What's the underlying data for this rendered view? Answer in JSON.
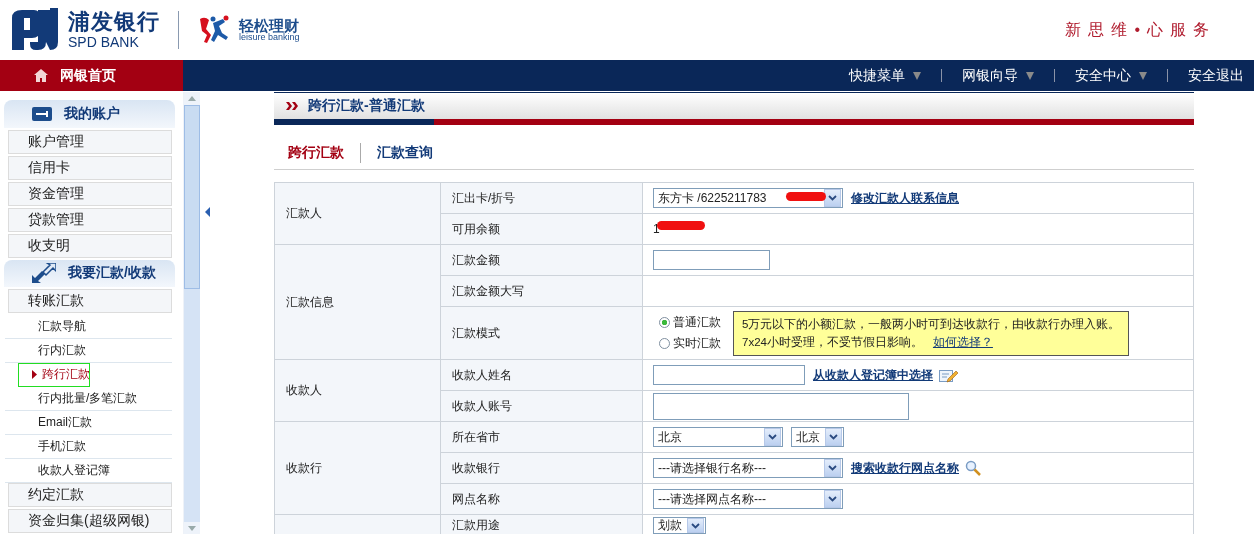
{
  "header": {
    "bank_name": "浦发银行",
    "bank_name_en": "SPD BANK",
    "brand": "轻松理财",
    "brand_en": "leisure banking",
    "slogan": "新思维•心服务"
  },
  "nav": {
    "home": "网银首页",
    "items": [
      {
        "label": "快捷菜单",
        "has_menu": true
      },
      {
        "label": "网银向导",
        "has_menu": true
      },
      {
        "label": "安全中心",
        "has_menu": true
      },
      {
        "label": "安全退出",
        "has_menu": false
      }
    ]
  },
  "sidebar": {
    "sections": [
      {
        "title": "我的账户",
        "items": [
          {
            "label": "账户管理",
            "kind": "main",
            "selected": false
          },
          {
            "label": "信用卡",
            "kind": "main",
            "selected": false
          },
          {
            "label": "资金管理",
            "kind": "main",
            "selected": false
          },
          {
            "label": "贷款管理",
            "kind": "main",
            "selected": false
          },
          {
            "label": "收支明",
            "kind": "main",
            "selected": false
          }
        ]
      },
      {
        "title": "我要汇款/收款",
        "items": [
          {
            "label": "转账汇款",
            "kind": "main",
            "selected": false
          },
          {
            "label": "汇款导航",
            "kind": "sub",
            "selected": false
          },
          {
            "label": "行内汇款",
            "kind": "sub",
            "selected": false
          },
          {
            "label": "跨行汇款",
            "kind": "sub",
            "selected": true
          },
          {
            "label": "行内批量/多笔汇款",
            "kind": "sub",
            "selected": false
          },
          {
            "label": "Email汇款",
            "kind": "sub",
            "selected": false
          },
          {
            "label": "手机汇款",
            "kind": "sub",
            "selected": false
          },
          {
            "label": "收款人登记簿",
            "kind": "sub",
            "selected": false
          },
          {
            "label": "约定汇款",
            "kind": "main",
            "selected": false
          },
          {
            "label": "资金归集(超级网银)",
            "kind": "main",
            "selected": false
          }
        ]
      }
    ]
  },
  "page_title": "跨行汇款-普通汇款",
  "tabs": [
    {
      "label": "跨行汇款",
      "selected": true
    },
    {
      "label": "汇款查询",
      "selected": false
    }
  ],
  "form": {
    "groups": [
      {
        "label": "汇款人",
        "rows": [
          {
            "label": "汇出卡/折号",
            "controls": [
              {
                "kind": "select",
                "value": "东方卡 /6225211783",
                "redacted": true
              },
              {
                "kind": "link",
                "text": "修改汇款人联系信息"
              }
            ]
          },
          {
            "label": "可用余额",
            "controls": [
              {
                "kind": "text",
                "value": "1",
                "redacted": true
              }
            ]
          }
        ]
      },
      {
        "label": "汇款信息",
        "rows": [
          {
            "label": "汇款金额",
            "controls": [
              {
                "kind": "input"
              }
            ]
          },
          {
            "label": "汇款金额大写",
            "controls": []
          },
          {
            "label": "汇款模式",
            "controls": [
              {
                "kind": "radio",
                "options": [
                  {
                    "label": "普通汇款",
                    "selected": true
                  },
                  {
                    "label": "实时汇款",
                    "selected": false
                  }
                ]
              },
              {
                "kind": "tip",
                "text": "5万元以下的小额汇款，一般两小时可到达收款行，由收款行办理入账。",
                "text2": "7x24小时受理，不受节假日影响。",
                "link": "如何选择？"
              }
            ]
          }
        ]
      },
      {
        "label": "收款人",
        "rows": [
          {
            "label": "收款人姓名",
            "controls": [
              {
                "kind": "input"
              },
              {
                "kind": "link",
                "text": "从收款人登记簿中选择"
              }
            ]
          },
          {
            "label": "收款人账号",
            "controls": [
              {
                "kind": "input"
              }
            ]
          }
        ]
      },
      {
        "label": "收款行",
        "rows": [
          {
            "label": "所在省市",
            "controls": [
              {
                "kind": "select",
                "value": "北京"
              },
              {
                "kind": "select",
                "value": "北京"
              }
            ]
          },
          {
            "label": "收款银行",
            "controls": [
              {
                "kind": "select",
                "value": "---请选择银行名称---"
              },
              {
                "kind": "link",
                "text": "搜索收款行网点名称"
              }
            ]
          },
          {
            "label": "网点名称",
            "controls": [
              {
                "kind": "select",
                "value": "---请选择网点名称---"
              }
            ]
          }
        ]
      },
      {
        "rows": [
          {
            "label": "汇款用途",
            "controls": [
              {
                "kind": "select",
                "value": "划款"
              }
            ]
          }
        ]
      }
    ]
  }
}
